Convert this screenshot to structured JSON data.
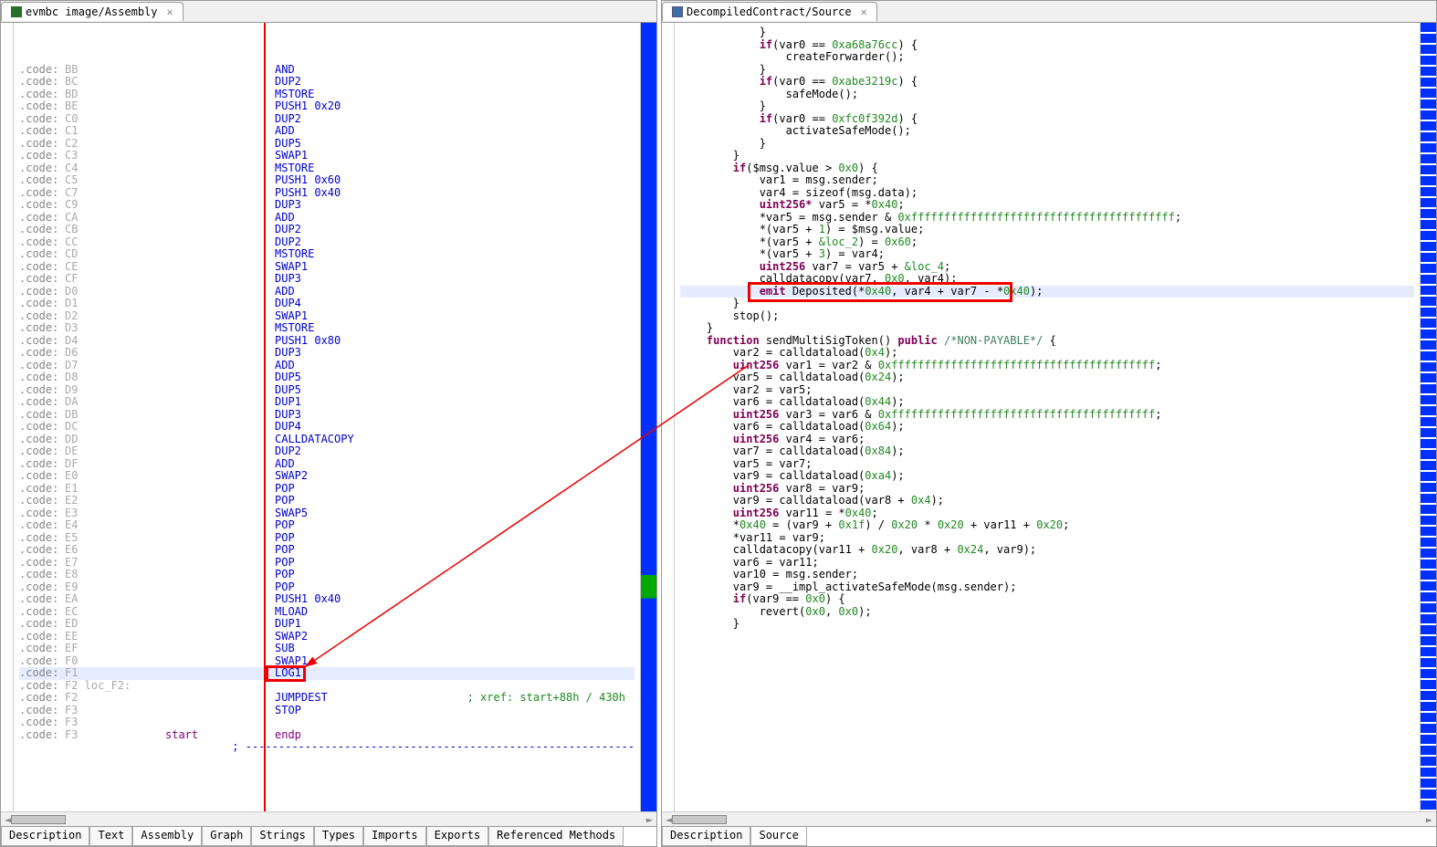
{
  "left_tab": "evmbc image/Assembly",
  "right_tab": "DecompiledContract/Source",
  "bottom_tabs_left": [
    "Description",
    "Text",
    "Assembly",
    "Graph",
    "Strings",
    "Types",
    "Imports",
    "Exports",
    "Referenced Methods"
  ],
  "bottom_tabs_right": [
    "Description",
    "Source"
  ],
  "active_btab_left": "Assembly",
  "active_btab_right": "Source",
  "asm": [
    {
      "l": ".code:",
      "a": "BB",
      "r": "",
      "op": "AND"
    },
    {
      "l": ".code:",
      "a": "BC",
      "r": "",
      "op": "DUP2"
    },
    {
      "l": ".code:",
      "a": "BD",
      "r": "",
      "op": "MSTORE"
    },
    {
      "l": ".code:",
      "a": "BE",
      "r": "",
      "op": "PUSH1 0x20"
    },
    {
      "l": ".code:",
      "a": "C0",
      "r": "",
      "op": "DUP2"
    },
    {
      "l": ".code:",
      "a": "C1",
      "r": "",
      "op": "ADD"
    },
    {
      "l": ".code:",
      "a": "C2",
      "r": "",
      "op": "DUP5"
    },
    {
      "l": ".code:",
      "a": "C3",
      "r": "",
      "op": "SWAP1"
    },
    {
      "l": ".code:",
      "a": "C4",
      "r": "",
      "op": "MSTORE"
    },
    {
      "l": ".code:",
      "a": "C5",
      "r": "",
      "op": "PUSH1 0x60"
    },
    {
      "l": ".code:",
      "a": "C7",
      "r": "",
      "op": "PUSH1 0x40"
    },
    {
      "l": ".code:",
      "a": "C9",
      "r": "",
      "op": "DUP3"
    },
    {
      "l": ".code:",
      "a": "CA",
      "r": "",
      "op": "ADD"
    },
    {
      "l": ".code:",
      "a": "CB",
      "r": "",
      "op": "DUP2"
    },
    {
      "l": ".code:",
      "a": "CC",
      "r": "",
      "op": "DUP2"
    },
    {
      "l": ".code:",
      "a": "CD",
      "r": "",
      "op": "MSTORE"
    },
    {
      "l": ".code:",
      "a": "CE",
      "r": "",
      "op": "SWAP1"
    },
    {
      "l": ".code:",
      "a": "CF",
      "r": "",
      "op": "DUP3"
    },
    {
      "l": ".code:",
      "a": "D0",
      "r": "",
      "op": "ADD"
    },
    {
      "l": ".code:",
      "a": "D1",
      "r": "",
      "op": "DUP4"
    },
    {
      "l": ".code:",
      "a": "D2",
      "r": "",
      "op": "SWAP1"
    },
    {
      "l": ".code:",
      "a": "D3",
      "r": "",
      "op": "MSTORE"
    },
    {
      "l": ".code:",
      "a": "D4",
      "r": "",
      "op": "PUSH1 0x80"
    },
    {
      "l": ".code:",
      "a": "D6",
      "r": "",
      "op": "DUP3"
    },
    {
      "l": ".code:",
      "a": "D7",
      "r": "",
      "op": "ADD"
    },
    {
      "l": ".code:",
      "a": "D8",
      "r": "",
      "op": "DUP5"
    },
    {
      "l": ".code:",
      "a": "D9",
      "r": "",
      "op": "DUP5"
    },
    {
      "l": ".code:",
      "a": "DA",
      "r": "",
      "op": "DUP1"
    },
    {
      "l": ".code:",
      "a": "DB",
      "r": "",
      "op": "DUP3"
    },
    {
      "l": ".code:",
      "a": "DC",
      "r": "",
      "op": "DUP4"
    },
    {
      "l": ".code:",
      "a": "DD",
      "r": "",
      "op": "CALLDATACOPY"
    },
    {
      "l": ".code:",
      "a": "DE",
      "r": "",
      "op": "DUP2"
    },
    {
      "l": ".code:",
      "a": "DF",
      "r": "",
      "op": "ADD"
    },
    {
      "l": ".code:",
      "a": "E0",
      "r": "",
      "op": "SWAP2"
    },
    {
      "l": ".code:",
      "a": "E1",
      "r": "",
      "op": "POP"
    },
    {
      "l": ".code:",
      "a": "E2",
      "r": "",
      "op": "POP"
    },
    {
      "l": ".code:",
      "a": "E3",
      "r": "",
      "op": "SWAP5"
    },
    {
      "l": ".code:",
      "a": "E4",
      "r": "",
      "op": "POP"
    },
    {
      "l": ".code:",
      "a": "E5",
      "r": "",
      "op": "POP"
    },
    {
      "l": ".code:",
      "a": "E6",
      "r": "",
      "op": "POP"
    },
    {
      "l": ".code:",
      "a": "E7",
      "r": "",
      "op": "POP"
    },
    {
      "l": ".code:",
      "a": "E8",
      "r": "",
      "op": "POP"
    },
    {
      "l": ".code:",
      "a": "E9",
      "r": "",
      "op": "POP"
    },
    {
      "l": ".code:",
      "a": "EA",
      "r": "",
      "op": "PUSH1 0x40"
    },
    {
      "l": ".code:",
      "a": "EC",
      "r": "",
      "op": "MLOAD"
    },
    {
      "l": ".code:",
      "a": "ED",
      "r": "",
      "op": "DUP1"
    },
    {
      "l": ".code:",
      "a": "EE",
      "r": "",
      "op": "SWAP2"
    },
    {
      "l": ".code:",
      "a": "EF",
      "r": "",
      "op": "SUB"
    },
    {
      "l": ".code:",
      "a": "F0",
      "r": "",
      "op": "SWAP1"
    },
    {
      "l": ".code:",
      "a": "F1",
      "r": "",
      "op": "LOG1",
      "hl": true,
      "box": true
    },
    {
      "l": ".code:",
      "a": "F2 loc_F2:",
      "r": "",
      "op": ""
    },
    {
      "l": ".code:",
      "a": "F2",
      "r": "",
      "op": "JUMPDEST",
      "cmt": "; xref: start+88h / 430h"
    },
    {
      "l": ".code:",
      "a": "F3",
      "r": "",
      "op": "STOP"
    },
    {
      "l": ".code:",
      "a": "F3",
      "r": "",
      "op": ""
    },
    {
      "l": ".code:",
      "a": "F3",
      "r": "start",
      "op": "endp",
      "purple": true
    },
    {
      "l": "",
      "a": "",
      "r": "",
      "op": "; -----------------------------------------------------------"
    }
  ],
  "src_lines": [
    {
      "indent": 12,
      "t": "}"
    },
    {
      "indent": 0,
      "t": ""
    },
    {
      "indent": 12,
      "seg": [
        {
          "kw": "if"
        },
        {
          "t": "(var0 == "
        },
        {
          "num": "0xa68a76cc"
        },
        {
          "t": ") {"
        }
      ]
    },
    {
      "indent": 16,
      "t": "createForwarder();"
    },
    {
      "indent": 12,
      "t": "}"
    },
    {
      "indent": 0,
      "t": ""
    },
    {
      "indent": 12,
      "seg": [
        {
          "kw": "if"
        },
        {
          "t": "(var0 == "
        },
        {
          "num": "0xabe3219c"
        },
        {
          "t": ") {"
        }
      ]
    },
    {
      "indent": 16,
      "t": "safeMode();"
    },
    {
      "indent": 12,
      "t": "}"
    },
    {
      "indent": 0,
      "t": ""
    },
    {
      "indent": 12,
      "seg": [
        {
          "kw": "if"
        },
        {
          "t": "(var0 == "
        },
        {
          "num": "0xfc0f392d"
        },
        {
          "t": ") {"
        }
      ]
    },
    {
      "indent": 16,
      "t": "activateSafeMode();"
    },
    {
      "indent": 12,
      "t": "}"
    },
    {
      "indent": 8,
      "t": "}"
    },
    {
      "indent": 0,
      "t": ""
    },
    {
      "indent": 8,
      "seg": [
        {
          "kw": "if"
        },
        {
          "t": "($msg.value > "
        },
        {
          "num": "0x0"
        },
        {
          "t": ") {"
        }
      ]
    },
    {
      "indent": 12,
      "t": "var1 = msg.sender;"
    },
    {
      "indent": 12,
      "t": "var4 = sizeof(msg.data);"
    },
    {
      "indent": 12,
      "seg": [
        {
          "kw": "uint256*"
        },
        {
          "t": " var5 = *"
        },
        {
          "num": "0x40"
        },
        {
          "t": ";"
        }
      ]
    },
    {
      "indent": 12,
      "seg": [
        {
          "t": "*var5 = msg.sender & "
        },
        {
          "num": "0xffffffffffffffffffffffffffffffffffffffff"
        },
        {
          "t": ";"
        }
      ]
    },
    {
      "indent": 12,
      "seg": [
        {
          "t": "*(var5 + "
        },
        {
          "num": "1"
        },
        {
          "t": ") = $msg.value;"
        }
      ]
    },
    {
      "indent": 12,
      "seg": [
        {
          "t": "*(var5 + "
        },
        {
          "num": "&loc_2"
        },
        {
          "t": ") = "
        },
        {
          "num": "0x60"
        },
        {
          "t": ";"
        }
      ]
    },
    {
      "indent": 12,
      "seg": [
        {
          "t": "*(var5 + "
        },
        {
          "num": "3"
        },
        {
          "t": ") = var4;"
        }
      ]
    },
    {
      "indent": 12,
      "seg": [
        {
          "kw": "uint256"
        },
        {
          "t": " var7 = var5 + "
        },
        {
          "num": "&loc_4"
        },
        {
          "t": ";"
        }
      ]
    },
    {
      "indent": 12,
      "seg": [
        {
          "t": "calldatacopy(var7, "
        },
        {
          "num": "0x0"
        },
        {
          "t": ", var4);"
        }
      ]
    },
    {
      "indent": 12,
      "hl": true,
      "box": true,
      "seg": [
        {
          "kw": "emit"
        },
        {
          "t": " Deposited(*"
        },
        {
          "num": "0x40"
        },
        {
          "t": ", var4 + var7 - *"
        },
        {
          "num": "0x40"
        },
        {
          "t": ");"
        }
      ]
    },
    {
      "indent": 8,
      "t": "}"
    },
    {
      "indent": 0,
      "t": ""
    },
    {
      "indent": 8,
      "t": "stop();"
    },
    {
      "indent": 4,
      "t": "}"
    },
    {
      "indent": 0,
      "t": ""
    },
    {
      "indent": 4,
      "seg": [
        {
          "kw": "function"
        },
        {
          "t": " sendMultiSigToken() "
        },
        {
          "kw": "public"
        },
        {
          "t": " "
        },
        {
          "cmt": "/*NON-PAYABLE*/"
        },
        {
          "t": " {"
        }
      ]
    },
    {
      "indent": 8,
      "seg": [
        {
          "t": "var2 = calldataload("
        },
        {
          "num": "0x4"
        },
        {
          "t": ");"
        }
      ]
    },
    {
      "indent": 8,
      "seg": [
        {
          "kw": "uint256"
        },
        {
          "t": " var1 = var2 & "
        },
        {
          "num": "0xffffffffffffffffffffffffffffffffffffffff"
        },
        {
          "t": ";"
        }
      ]
    },
    {
      "indent": 8,
      "seg": [
        {
          "t": "var5 = calldataload("
        },
        {
          "num": "0x24"
        },
        {
          "t": ");"
        }
      ]
    },
    {
      "indent": 8,
      "t": "var2 = var5;"
    },
    {
      "indent": 8,
      "seg": [
        {
          "t": "var6 = calldataload("
        },
        {
          "num": "0x44"
        },
        {
          "t": ");"
        }
      ]
    },
    {
      "indent": 8,
      "seg": [
        {
          "kw": "uint256"
        },
        {
          "t": " var3 = var6 & "
        },
        {
          "num": "0xffffffffffffffffffffffffffffffffffffffff"
        },
        {
          "t": ";"
        }
      ]
    },
    {
      "indent": 8,
      "seg": [
        {
          "t": "var6 = calldataload("
        },
        {
          "num": "0x64"
        },
        {
          "t": ");"
        }
      ]
    },
    {
      "indent": 8,
      "seg": [
        {
          "kw": "uint256"
        },
        {
          "t": " var4 = var6;"
        }
      ]
    },
    {
      "indent": 8,
      "seg": [
        {
          "t": "var7 = calldataload("
        },
        {
          "num": "0x84"
        },
        {
          "t": ");"
        }
      ]
    },
    {
      "indent": 8,
      "t": "var5 = var7;"
    },
    {
      "indent": 8,
      "seg": [
        {
          "t": "var9 = calldataload("
        },
        {
          "num": "0xa4"
        },
        {
          "t": ");"
        }
      ]
    },
    {
      "indent": 8,
      "seg": [
        {
          "kw": "uint256"
        },
        {
          "t": " var8 = var9;"
        }
      ]
    },
    {
      "indent": 8,
      "seg": [
        {
          "t": "var9 = calldataload(var8 + "
        },
        {
          "num": "0x4"
        },
        {
          "t": ");"
        }
      ]
    },
    {
      "indent": 8,
      "seg": [
        {
          "kw": "uint256"
        },
        {
          "t": " var11 = *"
        },
        {
          "num": "0x40"
        },
        {
          "t": ";"
        }
      ]
    },
    {
      "indent": 8,
      "seg": [
        {
          "t": "*"
        },
        {
          "num": "0x40"
        },
        {
          "t": " = (var9 + "
        },
        {
          "num": "0x1f"
        },
        {
          "t": ") / "
        },
        {
          "num": "0x20"
        },
        {
          "t": " * "
        },
        {
          "num": "0x20"
        },
        {
          "t": " + var11 + "
        },
        {
          "num": "0x20"
        },
        {
          "t": ";"
        }
      ]
    },
    {
      "indent": 8,
      "t": "*var11 = var9;"
    },
    {
      "indent": 8,
      "seg": [
        {
          "t": "calldatacopy(var11 + "
        },
        {
          "num": "0x20"
        },
        {
          "t": ", var8 + "
        },
        {
          "num": "0x24"
        },
        {
          "t": ", var9);"
        }
      ]
    },
    {
      "indent": 8,
      "t": "var6 = var11;"
    },
    {
      "indent": 8,
      "t": "var10 = msg.sender;"
    },
    {
      "indent": 8,
      "t": "var9 = __impl_activateSafeMode(msg.sender);"
    },
    {
      "indent": 0,
      "t": ""
    },
    {
      "indent": 8,
      "seg": [
        {
          "kw": "if"
        },
        {
          "t": "(var9 == "
        },
        {
          "num": "0x0"
        },
        {
          "t": ") {"
        }
      ]
    },
    {
      "indent": 12,
      "seg": [
        {
          "t": "revert("
        },
        {
          "num": "0x0"
        },
        {
          "t": ", "
        },
        {
          "num": "0x0"
        },
        {
          "t": ");"
        }
      ]
    },
    {
      "indent": 8,
      "t": "}"
    }
  ]
}
